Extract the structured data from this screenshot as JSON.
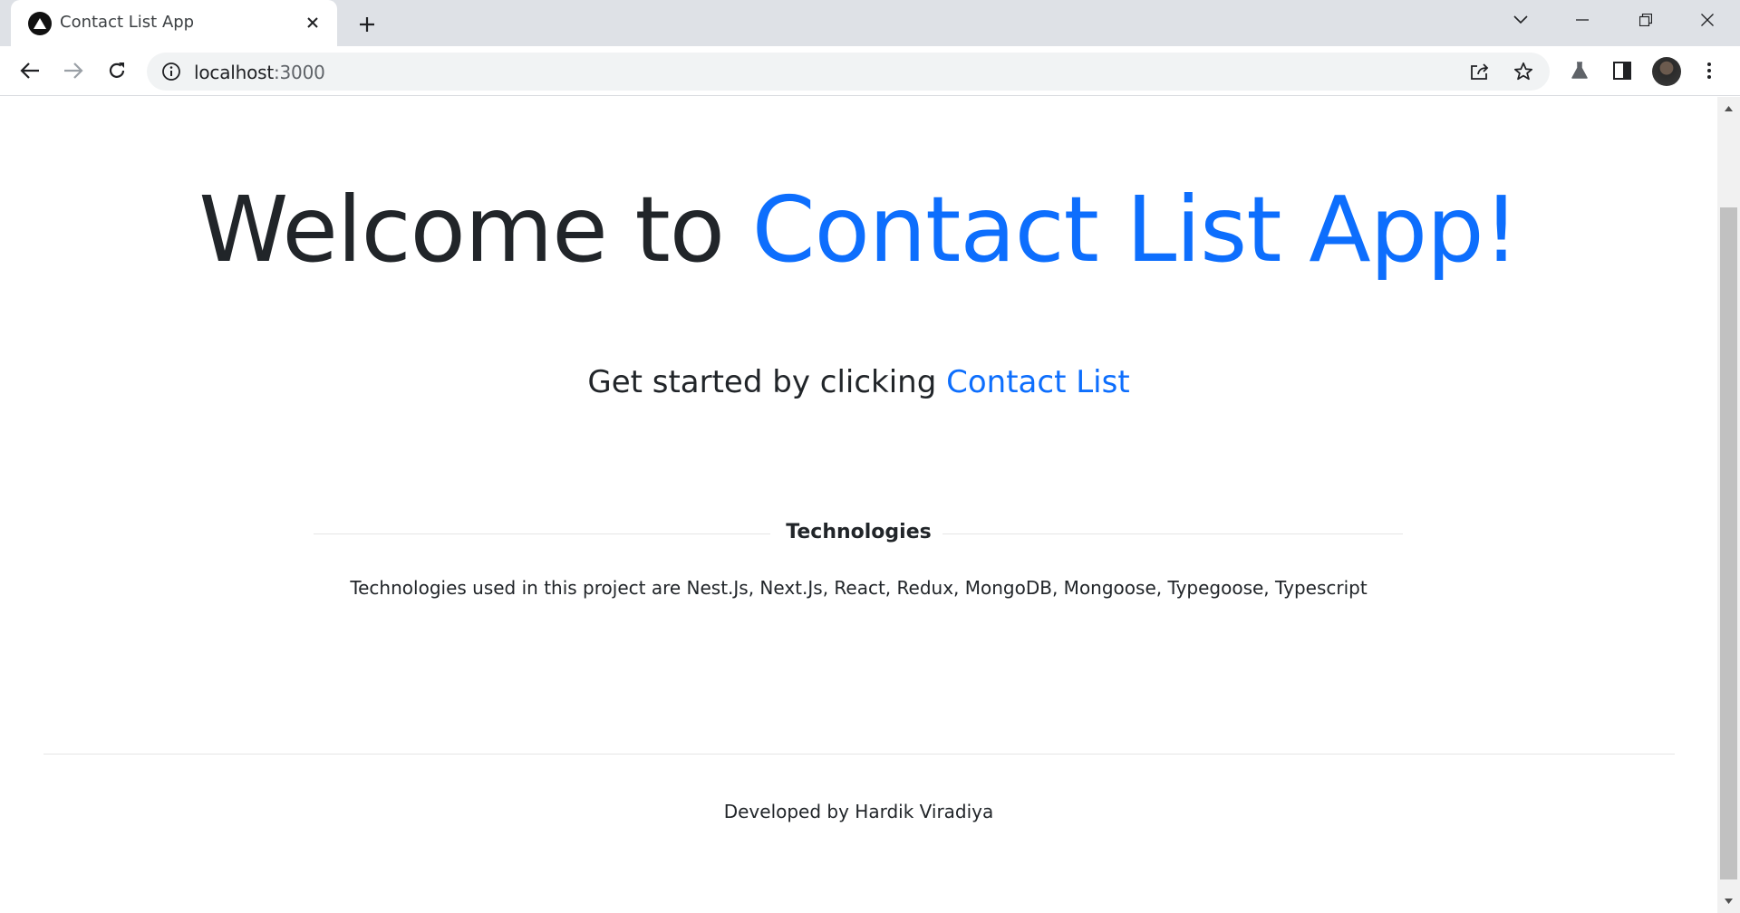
{
  "browser": {
    "tab_title": "Contact List App",
    "url_host": "localhost",
    "url_port": ":3000"
  },
  "page": {
    "headline_prefix": "Welcome to",
    "headline_accent": "Contact List App!",
    "subline_prefix": "Get started by clicking",
    "subline_link": "Contact List",
    "technologies_heading": "Technologies",
    "technologies_text": "Technologies used in this project are Nest.Js, Next.Js, React, Redux, MongoDB, Mongoose, Typegoose, Typescript",
    "footer_text": "Developed by Hardik Viradiya"
  },
  "colors": {
    "accent": "#0d6efd",
    "text": "#212529",
    "tabstrip": "#dee1e6",
    "omnibox": "#f1f3f4"
  },
  "icons": {
    "favicon": "triangle-logo-icon",
    "tab_close": "close-icon",
    "new_tab": "plus-icon",
    "back": "arrow-left-icon",
    "forward": "arrow-right-icon",
    "reload": "reload-icon",
    "site_info": "info-icon",
    "share": "share-icon",
    "bookmark": "star-icon",
    "labs": "flask-icon",
    "side_panel": "side-panel-icon",
    "menu": "kebab-menu-icon"
  }
}
